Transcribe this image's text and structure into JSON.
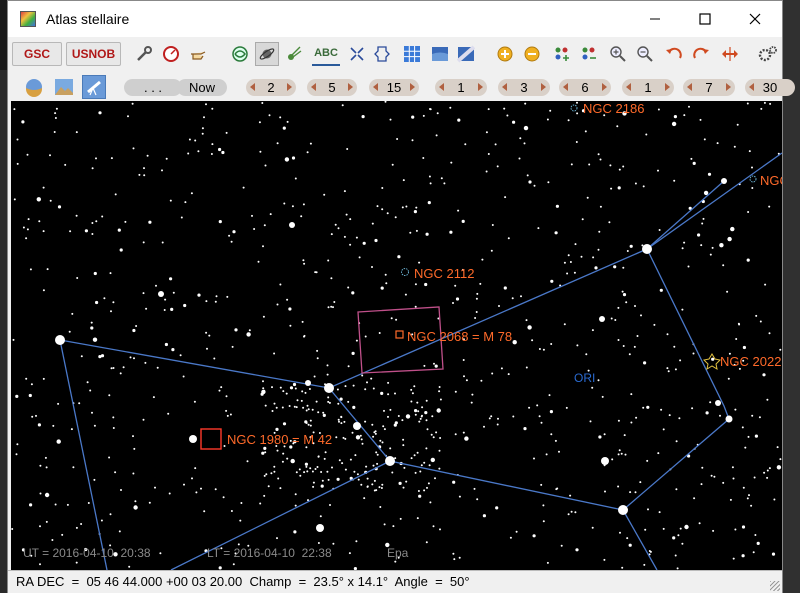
{
  "window": {
    "title": "Atlas stellaire"
  },
  "toolbar1": {
    "gsc_label": "GSC",
    "usnob_label": "USNOB",
    "abc_label": "ABC"
  },
  "toolbar2": {
    "dots_label": ". . .",
    "now_label": "Now",
    "steps": [
      "2",
      "5",
      "15",
      "1",
      "3",
      "6",
      "1",
      "7",
      "30"
    ]
  },
  "objects": [
    {
      "name": "NGC 2186",
      "kind": "open-cluster"
    },
    {
      "name": "NGC 2112",
      "kind": "open-cluster"
    },
    {
      "name": "NGC 2068 = M 78",
      "kind": "nebula"
    },
    {
      "name": "NGC 2022",
      "kind": "planetary-nebula"
    },
    {
      "name": "NGC 1980 = M 42",
      "kind": "nebula"
    },
    {
      "name": "NGC",
      "kind": "open-cluster"
    }
  ],
  "constellation_label": "ORI",
  "overlay": {
    "ut": "UT = 2016-04-10  20:38",
    "lt": "LT = 2016-04-10  22:38",
    "place": "Epa"
  },
  "status": {
    "text": "RA DEC  =  05 46 44.000 +00 03 20.00  Champ  =  23.5° x 14.1°  Angle  =  50°"
  },
  "colors": {
    "label": "#ff6a2a",
    "constellation_line": "#4a78c8",
    "fov": "#c0508a",
    "ori": "#2a6ad0"
  }
}
